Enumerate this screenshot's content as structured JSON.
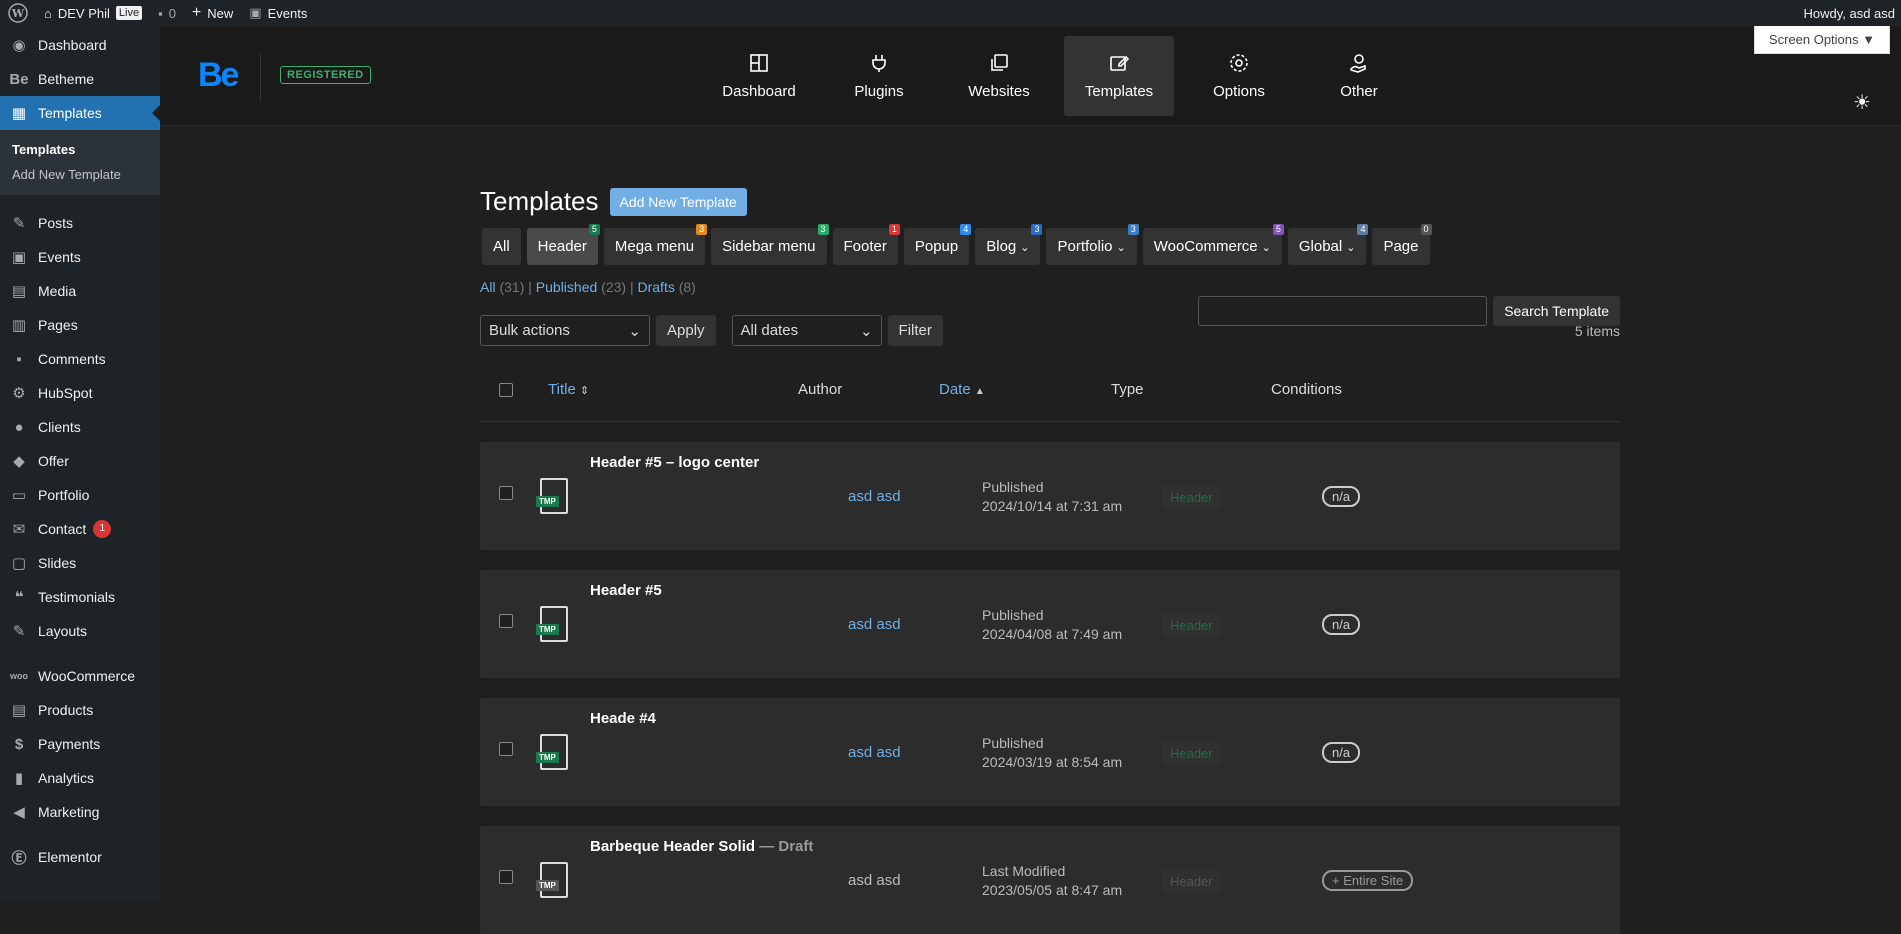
{
  "adminbar": {
    "site_name": "DEV Phil",
    "live_label": "Live",
    "comments_count": "0",
    "new_label": "New",
    "events_label": "Events",
    "howdy": "Howdy, asd asd"
  },
  "sidebar": {
    "items": [
      {
        "label": "Dashboard",
        "icon": "dashboard-icon"
      },
      {
        "label": "Betheme",
        "icon": "be-icon"
      },
      {
        "label": "Templates",
        "icon": "templates-icon",
        "active": true
      }
    ],
    "submenu": [
      "Templates",
      "Add New Template"
    ],
    "items2": [
      {
        "label": "Posts"
      },
      {
        "label": "Events"
      },
      {
        "label": "Media"
      },
      {
        "label": "Pages"
      },
      {
        "label": "Comments"
      },
      {
        "label": "HubSpot"
      },
      {
        "label": "Clients"
      },
      {
        "label": "Offer"
      },
      {
        "label": "Portfolio"
      },
      {
        "label": "Contact",
        "badge": "1"
      },
      {
        "label": "Slides"
      },
      {
        "label": "Testimonials"
      },
      {
        "label": "Layouts"
      }
    ],
    "items3": [
      {
        "label": "WooCommerce"
      },
      {
        "label": "Products"
      },
      {
        "label": "Payments"
      },
      {
        "label": "Analytics"
      },
      {
        "label": "Marketing"
      }
    ],
    "items4": [
      {
        "label": "Elementor"
      }
    ]
  },
  "topnav": {
    "logo": "Be",
    "registered": "REGISTERED",
    "items": [
      "Dashboard",
      "Plugins",
      "Websites",
      "Templates",
      "Options",
      "Other"
    ],
    "screen_options": "Screen Options ▼"
  },
  "main": {
    "title": "Templates",
    "add_new": "Add New Template",
    "categories": [
      {
        "label": "All",
        "count": "",
        "color": ""
      },
      {
        "label": "Header",
        "count": "5",
        "color": "#1a7a4f"
      },
      {
        "label": "Mega menu",
        "count": "3",
        "color": "#e08a1e"
      },
      {
        "label": "Sidebar menu",
        "count": "3",
        "color": "#2ca86a"
      },
      {
        "label": "Footer",
        "count": "1",
        "color": "#d63638"
      },
      {
        "label": "Popup",
        "count": "4",
        "color": "#2c8cf0"
      },
      {
        "label": "Blog",
        "count": "3",
        "color": "#2c6cc0"
      },
      {
        "label": "Portfolio",
        "count": "3",
        "color": "#3c7cc0"
      },
      {
        "label": "WooCommerce",
        "count": "5",
        "color": "#7f54b3"
      },
      {
        "label": "Global",
        "count": "4",
        "color": "#5c7ca0"
      },
      {
        "label": "Page",
        "count": "0",
        "color": "#555"
      }
    ],
    "subsub": {
      "all": "All",
      "all_count": "(31)",
      "published": "Published",
      "published_count": "(23)",
      "drafts": "Drafts",
      "drafts_count": "(8)"
    },
    "search_button": "Search Template",
    "bulk_actions": "Bulk actions",
    "apply": "Apply",
    "all_dates": "All dates",
    "filter": "Filter",
    "items_count": "5 items",
    "columns": {
      "title": "Title",
      "author": "Author",
      "date": "Date",
      "type": "Type",
      "conditions": "Conditions"
    },
    "rows": [
      {
        "title": "Header #5 – logo center",
        "draft": "",
        "author": "asd asd",
        "status": "Published",
        "date": "2024/10/14 at 7:31 am",
        "type": "Header",
        "cond": "n/a"
      },
      {
        "title": "Header #5",
        "draft": "",
        "author": "asd asd",
        "status": "Published",
        "date": "2024/04/08 at 7:49 am",
        "type": "Header",
        "cond": "n/a"
      },
      {
        "title": "Heade #4",
        "draft": "",
        "author": "asd asd",
        "status": "Published",
        "date": "2024/03/19 at 8:54 am",
        "type": "Header",
        "cond": "n/a"
      },
      {
        "title": "Barbeque Header Solid",
        "draft": " — Draft",
        "author": "asd asd",
        "status": "Last Modified",
        "date": "2023/05/05 at 8:47 am",
        "type": "Header",
        "cond": "+ Entire Site"
      }
    ]
  }
}
